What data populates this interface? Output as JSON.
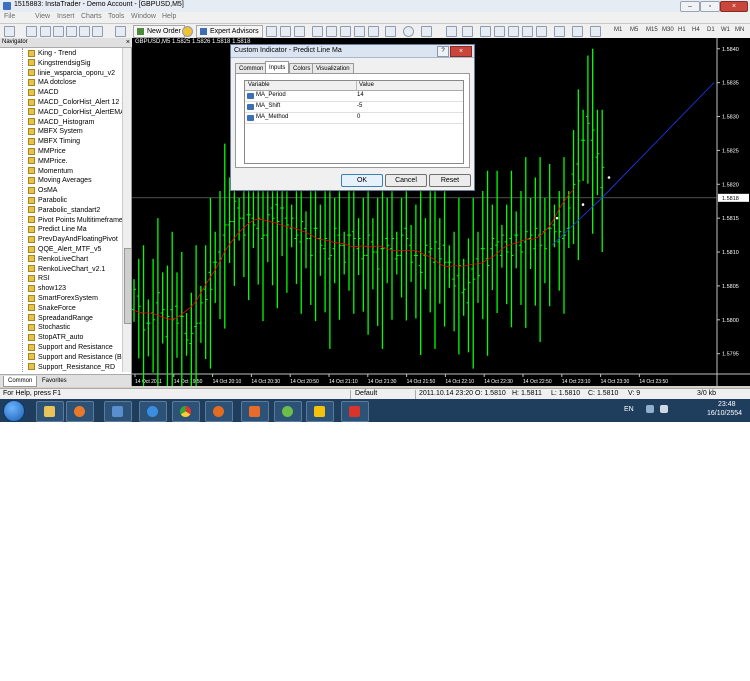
{
  "window": {
    "title": "1515883: InstaTrader - Demo Account - [GBPUSD,M5]"
  },
  "menu": [
    "File",
    "View",
    "Insert",
    "Charts",
    "Tools",
    "Window",
    "Help"
  ],
  "toolbar": {
    "new_order": "New Order",
    "expert_advisors": "Expert Advisors",
    "timeframes": [
      "M1",
      "M5",
      "M15",
      "M30",
      "H1",
      "H4",
      "D1",
      "W1",
      "MN"
    ]
  },
  "navigator": {
    "title": "Navigator",
    "close": "×",
    "items": [
      "King - Trend",
      "KingstrendsigSig",
      "linie_wsparcia_oporu_v2",
      "MA dotclose",
      "MACD",
      "MACD_ColorHist_Alert 12 ...",
      "MACD_ColorHist_AlertEMA",
      "MACD_Histogram",
      "MBFX System",
      "MBFX Timing",
      "MMPrice",
      "MMPrice.",
      "Momentum",
      "Moving Averages",
      "OsMA",
      "Parabolic",
      "Parabolic_standart2",
      "Pivot Points Multitimeframe",
      "Predict Line Ma",
      "PrevDayAndFloatingPivot",
      "QQE_Alert_MTF_v5",
      "RenkoLiveChart",
      "RenkoLiveChart_v2.1",
      "RSI",
      "show123",
      "SmartForexSystem",
      "SnakeForce",
      "SpreadandRange",
      "Stochastic",
      "StopATR_auto",
      "Support and Resistance",
      "Support and Resistance (Bar...",
      "Support_Resistance_RD"
    ],
    "tabs": [
      "Common",
      "Favorites"
    ]
  },
  "chart": {
    "header": "GBPUSD,M5  1.5825 1.5826 1.5818 1.5818",
    "price_labels": [
      "1.5840",
      "1.5835",
      "1.5830",
      "1.5825",
      "1.5820",
      "1.5815",
      "1.5810",
      "1.5805",
      "1.5800",
      "1.5795"
    ],
    "current_price": "1.5818",
    "time_labels": [
      "14 Oct 2011",
      "14 Oct 19:50",
      "14 Oct 20:10",
      "14 Oct 20:30",
      "14 Oct 20:50",
      "14 Oct 21:10",
      "14 Oct 21:30",
      "14 Oct 21:50",
      "14 Oct 22:10",
      "14 Oct 22:30",
      "14 Oct 22:50",
      "14 Oct 23:10",
      "14 Oct 23:30",
      "14 Oct 23:50"
    ],
    "colors": {
      "up": "#00ff00",
      "down": "#00ff00",
      "ma": "#ff0000",
      "predict": "#1e3cff",
      "background": "#000000"
    }
  },
  "dialog": {
    "title": "Custom Indicator - Predict Line Ma",
    "help": "?",
    "close": "×",
    "tabs": [
      "Common",
      "Inputs",
      "Colors",
      "Visualization"
    ],
    "active_tab": "Inputs",
    "columns": [
      "Variable",
      "Value"
    ],
    "rows": [
      {
        "variable": "MA_Period",
        "value": "14"
      },
      {
        "variable": "MA_Shift",
        "value": "-5"
      },
      {
        "variable": "MA_Method",
        "value": "0"
      }
    ],
    "buttons": {
      "ok": "OK",
      "cancel": "Cancel",
      "reset": "Reset"
    }
  },
  "status": {
    "help": "For Help, press F1",
    "profile": "Default",
    "time": "2011.10.14 23:20",
    "open": "O: 1.5810",
    "high": "H: 1.5811",
    "low": "L: 1.5810",
    "close": "C: 1.5810",
    "volume": "V: 9",
    "traffic": "3/0 kb"
  },
  "tray": {
    "lang": "EN",
    "time": "23:48",
    "date": "16/10/2554"
  }
}
